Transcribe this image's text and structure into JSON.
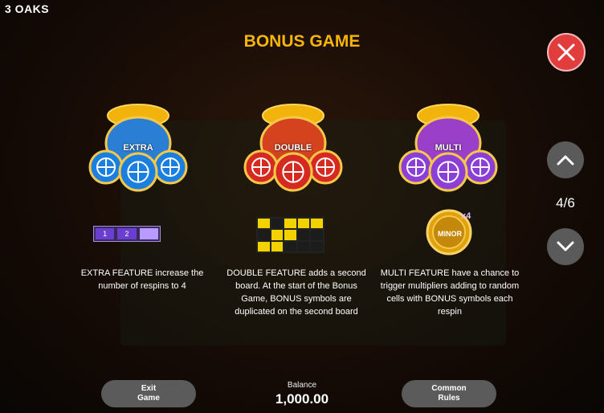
{
  "brand": "3 OAKS",
  "title": "BONUS GAME",
  "page_indicator": "4/6",
  "features": [
    {
      "pot_label": "EXTRA",
      "pot_color": "#2a7fd4",
      "coin_color": "#1b7fe0",
      "description": "EXTRA FEATURE increase the number of respins to 4",
      "extra_cells": [
        "1",
        "2",
        ""
      ]
    },
    {
      "pot_label": "DOUBLE",
      "pot_color": "#d4421e",
      "coin_color": "#d62a20",
      "description": "DOUBLE FEATURE adds a second board. At the start of the Bonus Game, BONUS symbols are duplicated on the second board"
    },
    {
      "pot_label": "MULTI",
      "pot_color": "#9a3fc8",
      "coin_color": "#8b3fd6",
      "description": "MULTI FEATURE have a chance to trigger multipliers adding to random cells with BONUS symbols each respin",
      "coin_text": "MINOR",
      "coin_multiplier": "x4"
    }
  ],
  "double_grid": [
    1,
    0,
    1,
    1,
    1,
    0,
    1,
    1,
    0,
    0,
    1,
    1,
    0,
    0,
    0
  ],
  "buttons": {
    "exit": "Exit\nGame",
    "rules": "Common\nRules"
  },
  "balance": {
    "label": "Balance",
    "value": "1,000.00"
  },
  "colors": {
    "title": "#f5b50a",
    "close": "#e23d3d",
    "nav": "#5a5a5a"
  }
}
